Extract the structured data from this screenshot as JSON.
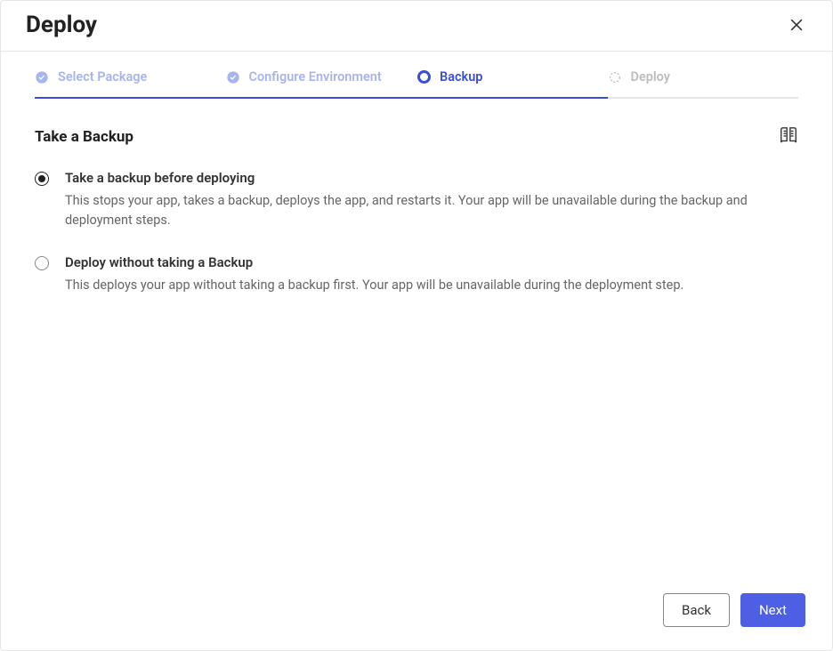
{
  "header": {
    "title": "Deploy"
  },
  "stepper": {
    "steps": [
      {
        "label": "Select Package",
        "status": "completed"
      },
      {
        "label": "Configure Environment",
        "status": "completed"
      },
      {
        "label": "Backup",
        "status": "current"
      },
      {
        "label": "Deploy",
        "status": "pending"
      }
    ]
  },
  "section": {
    "title": "Take a Backup"
  },
  "options": [
    {
      "title": "Take a backup before deploying",
      "description": "This stops your app, takes a backup, deploys the app, and restarts it. Your app will be unavailable during the backup and deployment steps.",
      "selected": true
    },
    {
      "title": "Deploy without taking a Backup",
      "description": "This deploys your app without taking a backup first. Your app will be unavailable during the deployment step.",
      "selected": false
    }
  ],
  "footer": {
    "back_label": "Back",
    "next_label": "Next"
  }
}
